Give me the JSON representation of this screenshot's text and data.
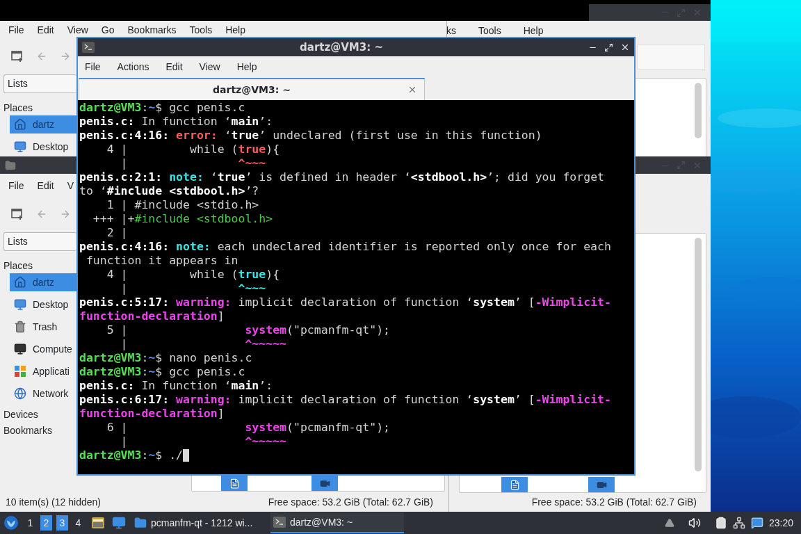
{
  "file_manager_top_left": {
    "menu": [
      "File",
      "Edit",
      "View",
      "Go",
      "Bookmarks",
      "Tools",
      "Help"
    ],
    "lists_label": "Lists",
    "places_heading": "Places",
    "places": [
      {
        "label": "dartz",
        "kind": "home",
        "selected": true
      },
      {
        "label": "Desktop",
        "kind": "desktop",
        "selected": false
      }
    ]
  },
  "file_manager_top_right": {
    "menu": [
      "ks",
      "Tools",
      "Help"
    ]
  },
  "file_manager_bottom_left": {
    "menu": [
      "File",
      "Edit",
      "V"
    ],
    "lists_label": "Lists",
    "places_heading": "Places",
    "places": [
      {
        "label": "dartz",
        "kind": "home",
        "selected": true
      },
      {
        "label": "Desktop",
        "kind": "desktop",
        "selected": false
      },
      {
        "label": "Trash",
        "kind": "trash",
        "selected": false
      },
      {
        "label": "Compute",
        "kind": "computer",
        "selected": false
      },
      {
        "label": "Applicati",
        "kind": "applications",
        "selected": false
      },
      {
        "label": "Network",
        "kind": "network",
        "selected": false
      }
    ],
    "sections": [
      "Devices",
      "Bookmarks"
    ],
    "status_left": "10 item(s) (12 hidden)",
    "status_right": "Free space: 53.2 GiB (Total: 62.7 GiB)"
  },
  "file_manager_bottom_right": {
    "status_right": "Free space: 53.2 GiB (Total: 62.7 GiB)"
  },
  "terminal": {
    "title": "dartz@VM3: ~",
    "menu": [
      "File",
      "Actions",
      "Edit",
      "View",
      "Help"
    ],
    "tabs": [
      {
        "label": "dartz@VM3: ~",
        "selected": true
      }
    ],
    "cursor": true,
    "lines": [
      {
        "segments": [
          {
            "kind": "user",
            "text": "dartz@VM3"
          },
          {
            "kind": "plain",
            "text": ":"
          },
          {
            "kind": "path",
            "text": "~"
          },
          {
            "kind": "plain",
            "text": "$ gcc penis.c"
          }
        ]
      },
      {
        "segments": [
          {
            "kind": "bold",
            "text": "penis.c:"
          },
          {
            "kind": "plain",
            "text": " In function ‘"
          },
          {
            "kind": "bold",
            "text": "main"
          },
          {
            "kind": "plain",
            "text": "’:"
          }
        ]
      },
      {
        "segments": [
          {
            "kind": "bold",
            "text": "penis.c:4:16: "
          },
          {
            "kind": "error",
            "text": "error: "
          },
          {
            "kind": "plain",
            "text": "‘"
          },
          {
            "kind": "bold",
            "text": "true"
          },
          {
            "kind": "plain",
            "text": "’ undeclared (first use in this function)"
          }
        ]
      },
      {
        "segments": [
          {
            "kind": "plain",
            "text": "    4 |         while ("
          },
          {
            "kind": "error",
            "text": "true"
          },
          {
            "kind": "plain",
            "text": "){"
          }
        ]
      },
      {
        "segments": [
          {
            "kind": "plain",
            "text": "      |                "
          },
          {
            "kind": "error",
            "text": "^~~~"
          }
        ]
      },
      {
        "segments": [
          {
            "kind": "bold",
            "text": "penis.c:2:1: "
          },
          {
            "kind": "note",
            "text": "note: "
          },
          {
            "kind": "plain",
            "text": "‘"
          },
          {
            "kind": "bold",
            "text": "true"
          },
          {
            "kind": "plain",
            "text": "’ is defined in header ‘"
          },
          {
            "kind": "bold",
            "text": "<stdbool.h>"
          },
          {
            "kind": "plain",
            "text": "’; did you forget"
          }
        ]
      },
      {
        "segments": [
          {
            "kind": "plain",
            "text": "to ‘"
          },
          {
            "kind": "bold",
            "text": "#include <stdbool.h>"
          },
          {
            "kind": "plain",
            "text": "’?"
          }
        ]
      },
      {
        "segments": [
          {
            "kind": "plain",
            "text": "    1 | #include <stdio.h>"
          }
        ]
      },
      {
        "segments": [
          {
            "kind": "plain",
            "text": "  +++ |+"
          },
          {
            "kind": "insert",
            "text": "#include <stdbool.h>"
          }
        ]
      },
      {
        "segments": [
          {
            "kind": "plain",
            "text": "    2 |"
          }
        ]
      },
      {
        "segments": [
          {
            "kind": "bold",
            "text": "penis.c:4:16: "
          },
          {
            "kind": "note",
            "text": "note: "
          },
          {
            "kind": "plain",
            "text": "each undeclared identifier is reported only once for each"
          }
        ]
      },
      {
        "segments": [
          {
            "kind": "plain",
            "text": " function it appears in"
          }
        ]
      },
      {
        "segments": [
          {
            "kind": "plain",
            "text": "    4 |         while ("
          },
          {
            "kind": "note",
            "text": "true"
          },
          {
            "kind": "plain",
            "text": "){"
          }
        ]
      },
      {
        "segments": [
          {
            "kind": "plain",
            "text": "      |                "
          },
          {
            "kind": "note",
            "text": "^~~~"
          }
        ]
      },
      {
        "segments": [
          {
            "kind": "bold",
            "text": "penis.c:5:17: "
          },
          {
            "kind": "warning",
            "text": "warning: "
          },
          {
            "kind": "plain",
            "text": "implicit declaration of function ‘"
          },
          {
            "kind": "bold",
            "text": "system"
          },
          {
            "kind": "plain",
            "text": "’ ["
          },
          {
            "kind": "warning",
            "text": "-Wimplicit-"
          }
        ]
      },
      {
        "segments": [
          {
            "kind": "warning",
            "text": "function-declaration"
          },
          {
            "kind": "plain",
            "text": "]"
          }
        ]
      },
      {
        "segments": [
          {
            "kind": "plain",
            "text": "    5 |                 "
          },
          {
            "kind": "warning",
            "text": "system"
          },
          {
            "kind": "plain",
            "text": "(\"pcmanfm-qt\");"
          }
        ]
      },
      {
        "segments": [
          {
            "kind": "plain",
            "text": "      |                 "
          },
          {
            "kind": "warning",
            "text": "^~~~~~"
          }
        ]
      },
      {
        "segments": [
          {
            "kind": "user",
            "text": "dartz@VM3"
          },
          {
            "kind": "plain",
            "text": ":"
          },
          {
            "kind": "path",
            "text": "~"
          },
          {
            "kind": "plain",
            "text": "$ nano penis.c"
          }
        ]
      },
      {
        "segments": [
          {
            "kind": "user",
            "text": "dartz@VM3"
          },
          {
            "kind": "plain",
            "text": ":"
          },
          {
            "kind": "path",
            "text": "~"
          },
          {
            "kind": "plain",
            "text": "$ gcc penis.c"
          }
        ]
      },
      {
        "segments": [
          {
            "kind": "bold",
            "text": "penis.c:"
          },
          {
            "kind": "plain",
            "text": " In function ‘"
          },
          {
            "kind": "bold",
            "text": "main"
          },
          {
            "kind": "plain",
            "text": "’:"
          }
        ]
      },
      {
        "segments": [
          {
            "kind": "bold",
            "text": "penis.c:6:17: "
          },
          {
            "kind": "warning",
            "text": "warning: "
          },
          {
            "kind": "plain",
            "text": "implicit declaration of function ‘"
          },
          {
            "kind": "bold",
            "text": "system"
          },
          {
            "kind": "plain",
            "text": "’ ["
          },
          {
            "kind": "warning",
            "text": "-Wimplicit-"
          }
        ]
      },
      {
        "segments": [
          {
            "kind": "warning",
            "text": "function-declaration"
          },
          {
            "kind": "plain",
            "text": "]"
          }
        ]
      },
      {
        "segments": [
          {
            "kind": "plain",
            "text": "    6 |                 "
          },
          {
            "kind": "warning",
            "text": "system"
          },
          {
            "kind": "plain",
            "text": "(\"pcmanfm-qt\");"
          }
        ]
      },
      {
        "segments": [
          {
            "kind": "plain",
            "text": "      |                 "
          },
          {
            "kind": "warning",
            "text": "^~~~~~"
          }
        ]
      },
      {
        "segments": [
          {
            "kind": "user",
            "text": "dartz@VM3"
          },
          {
            "kind": "plain",
            "text": ":"
          },
          {
            "kind": "path",
            "text": "~"
          },
          {
            "kind": "plain",
            "text": "$ ./"
          }
        ]
      }
    ]
  },
  "taskbar": {
    "workspaces": [
      {
        "label": "1",
        "selected": false
      },
      {
        "label": "2",
        "selected": true
      },
      {
        "label": "3",
        "selected": true
      },
      {
        "label": "4",
        "selected": false
      }
    ],
    "tasks": [
      {
        "label": "pcmanfm-qt - 1212 wi...",
        "kind": "folder",
        "selected": false
      },
      {
        "label": "dartz@VM3: ~",
        "kind": "terminal",
        "selected": true
      }
    ],
    "clock": "23:20"
  }
}
